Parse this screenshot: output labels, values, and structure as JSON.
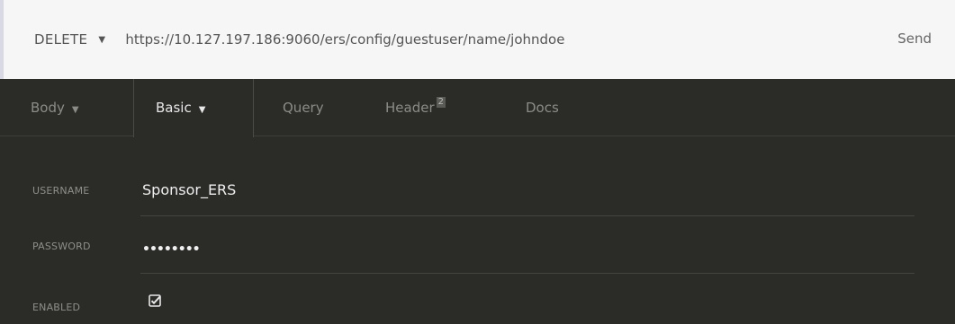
{
  "request": {
    "method": "DELETE",
    "url": "https://10.127.197.186:9060/ers/config/guestuser/name/johndoe",
    "send_label": "Send"
  },
  "tabs": [
    {
      "label": "Body",
      "has_dropdown": true,
      "active": false
    },
    {
      "label": "Basic",
      "has_dropdown": true,
      "active": true
    },
    {
      "label": "Query",
      "active": false
    },
    {
      "label": "Header",
      "badge": "2",
      "active": false
    },
    {
      "label": "Docs",
      "active": false
    }
  ],
  "auth": {
    "username_label": "USERNAME",
    "username_value": "Sponsor_ERS",
    "password_label": "PASSWORD",
    "password_mask": "••••••••",
    "enabled_label": "ENABLED",
    "enabled_checked": true
  },
  "colors": {
    "panel_bg": "#2b2b28",
    "urlbar_bg": "#f6f6f6",
    "text_primary": "#f0f0f0",
    "text_muted": "#8b8b87"
  },
  "icons": {
    "method_dropdown": "caret-down-icon",
    "enabled_checkbox": "checkbox-checked-icon"
  }
}
